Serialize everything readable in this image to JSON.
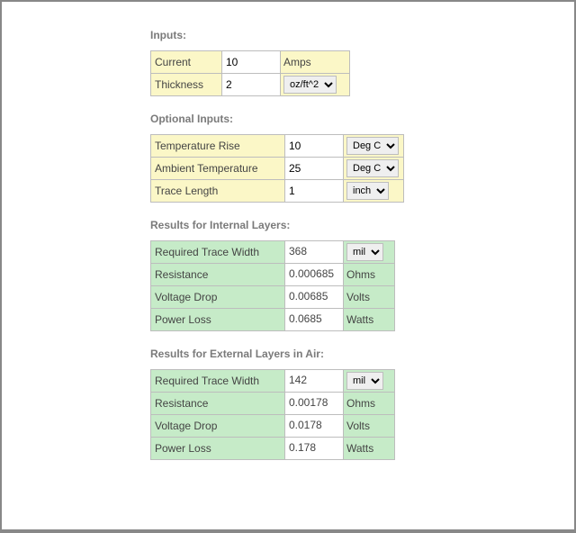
{
  "headings": {
    "inputs": "Inputs:",
    "optional": "Optional Inputs:",
    "internal": "Results for Internal Layers:",
    "external": "Results for External Layers in Air:"
  },
  "inputs": {
    "current": {
      "label": "Current",
      "value": "10",
      "unit": "Amps"
    },
    "thickness": {
      "label": "Thickness",
      "value": "2",
      "unit": "oz/ft^2"
    }
  },
  "optional": {
    "temp_rise": {
      "label": "Temperature Rise",
      "value": "10",
      "unit": "Deg C"
    },
    "ambient": {
      "label": "Ambient Temperature",
      "value": "25",
      "unit": "Deg C"
    },
    "trace_len": {
      "label": "Trace Length",
      "value": "1",
      "unit": "inch"
    }
  },
  "internal": {
    "trace_width": {
      "label": "Required Trace Width",
      "value": "368",
      "unit": "mil"
    },
    "resistance": {
      "label": "Resistance",
      "value": "0.000685",
      "unit": "Ohms"
    },
    "vdrop": {
      "label": "Voltage Drop",
      "value": "0.00685",
      "unit": "Volts"
    },
    "ploss": {
      "label": "Power Loss",
      "value": "0.0685",
      "unit": "Watts"
    }
  },
  "external": {
    "trace_width": {
      "label": "Required Trace Width",
      "value": "142",
      "unit": "mil"
    },
    "resistance": {
      "label": "Resistance",
      "value": "0.00178",
      "unit": "Ohms"
    },
    "vdrop": {
      "label": "Voltage Drop",
      "value": "0.0178",
      "unit": "Volts"
    },
    "ploss": {
      "label": "Power Loss",
      "value": "0.178",
      "unit": "Watts"
    }
  }
}
